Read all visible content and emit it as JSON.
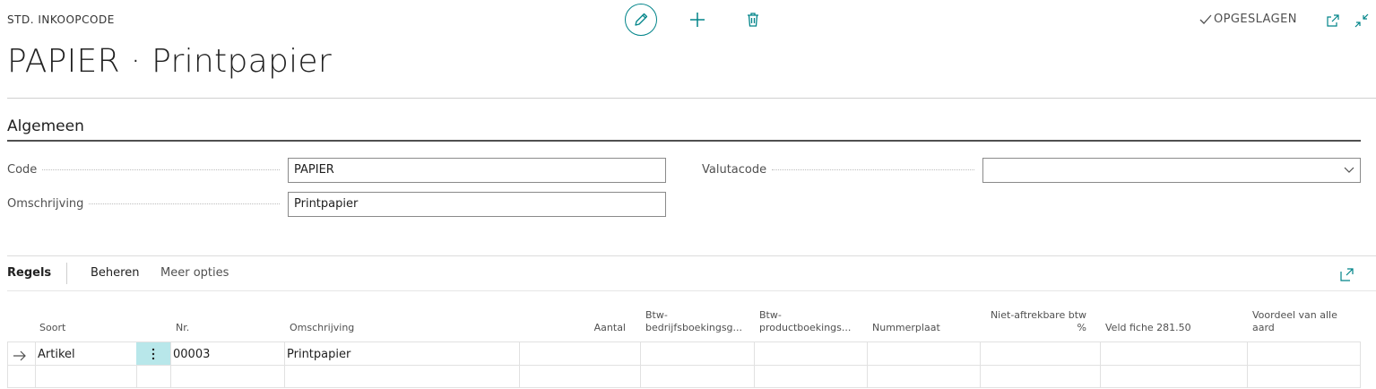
{
  "header": {
    "entity_caption": "STD. INKOOPCODE",
    "title": "PAPIER · Printpapier",
    "saved_label": "OPGESLAGEN",
    "accent_color": "#008489"
  },
  "section": {
    "title": "Algemeen",
    "fields": {
      "code": {
        "label": "Code",
        "value": "PAPIER"
      },
      "omschrijving": {
        "label": "Omschrijving",
        "value": "Printpapier"
      },
      "valutacode": {
        "label": "Valutacode",
        "value": ""
      }
    }
  },
  "subpage": {
    "tabs": [
      "Regels",
      "Beheren",
      "Meer opties"
    ],
    "columns": {
      "soort": "Soort",
      "nr": "Nr.",
      "omschrijving": "Omschrijving",
      "aantal": "Aantal",
      "btw_bedr_1": "Btw-",
      "btw_bedr_2": "bedrijfsboekingsg...",
      "btw_prod_1": "Btw-",
      "btw_prod_2": "productboekings...",
      "nummerplaat": "Nummerplaat",
      "niet_aftr_1": "Niet-aftrekbare btw",
      "niet_aftr_2": "%",
      "veld_fiche": "Veld fiche 281.50",
      "voordeel_1": "Voordeel van alle",
      "voordeel_2": "aard"
    },
    "rows": [
      {
        "soort": "Artikel",
        "nr": "00003",
        "omschrijving": "Printpapier"
      }
    ]
  }
}
